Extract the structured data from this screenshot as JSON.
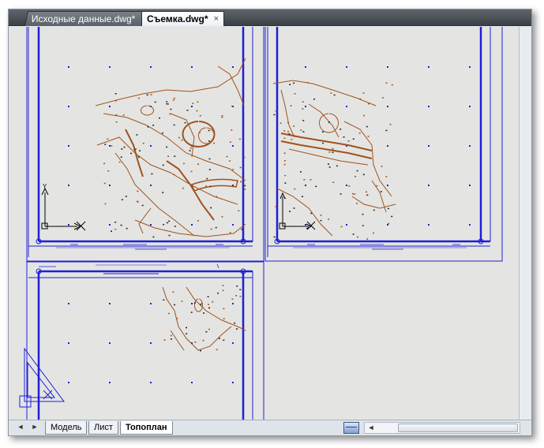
{
  "tabs": [
    {
      "label": "Исходные данные.dwg*"
    },
    {
      "label": "Съемка.dwg*",
      "active": true
    }
  ],
  "tab_close_glyph": "×",
  "layout_tabs": [
    {
      "label": "Модель"
    },
    {
      "label": "Лист"
    },
    {
      "label": "Топоплан",
      "active": true
    }
  ],
  "nav": {
    "prev": "◄",
    "next": "►",
    "scroll_left": "◄"
  },
  "ucs": {
    "y_label": "Y"
  },
  "colors": {
    "frame": "#1f1fd6",
    "survey": "#a0521e",
    "canvas": "#e4e5e2"
  },
  "icons": [
    "layout-sheet-icon",
    "nav-prev-icon",
    "nav-next-icon",
    "scroll-left-icon"
  ]
}
